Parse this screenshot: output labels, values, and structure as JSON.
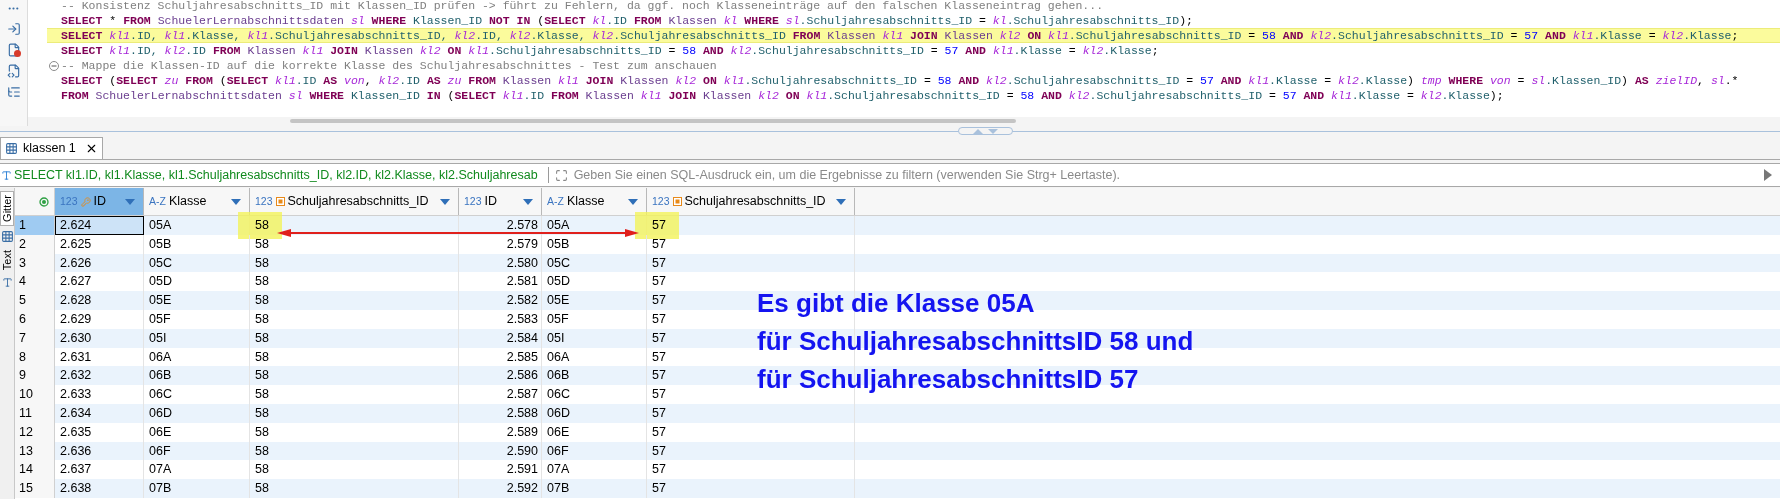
{
  "editor": {
    "lines": [
      {
        "fold_marker": false,
        "highlighted": false,
        "tokens": [
          {
            "kind": "comment",
            "text": "-- Konsistenz Schuljahresabschnitts_ID mit Klassen_ID prüfen -> führt zu Fehlern, da ggf. noch Klasseneinträge auf den falschen Klasseneintrag gehen..."
          }
        ]
      },
      {
        "fold_marker": false,
        "highlighted": false,
        "tokens": [
          {
            "kind": "keyword",
            "text": "SELECT "
          },
          {
            "kind": "plain",
            "text": "* "
          },
          {
            "kind": "keyword",
            "text": "FROM "
          },
          {
            "kind": "table",
            "text": "SchuelerLernabschnittsdaten "
          },
          {
            "kind": "alias",
            "text": "sl "
          },
          {
            "kind": "keyword",
            "text": "WHERE "
          },
          {
            "kind": "column",
            "text": "Klassen_ID "
          },
          {
            "kind": "keyword",
            "text": "NOT IN "
          },
          {
            "kind": "plain",
            "text": "("
          },
          {
            "kind": "keyword",
            "text": "SELECT "
          },
          {
            "kind": "alias",
            "text": "kl"
          },
          {
            "kind": "column",
            "text": ".ID "
          },
          {
            "kind": "keyword",
            "text": "FROM "
          },
          {
            "kind": "table",
            "text": "Klassen "
          },
          {
            "kind": "alias",
            "text": "kl "
          },
          {
            "kind": "keyword",
            "text": "WHERE "
          },
          {
            "kind": "alias",
            "text": "sl"
          },
          {
            "kind": "column",
            "text": ".Schuljahresabschnitts_ID "
          },
          {
            "kind": "plain",
            "text": "= "
          },
          {
            "kind": "alias",
            "text": "kl"
          },
          {
            "kind": "column",
            "text": ".Schuljahresabschnitts_ID"
          },
          {
            "kind": "plain",
            "text": ");"
          }
        ]
      },
      {
        "fold_marker": false,
        "highlighted": true,
        "tokens": [
          {
            "kind": "keyword",
            "text": "SELECT "
          },
          {
            "kind": "alias",
            "text": "kl1"
          },
          {
            "kind": "column",
            "text": ".ID, "
          },
          {
            "kind": "alias",
            "text": "kl1"
          },
          {
            "kind": "column",
            "text": ".Klasse, "
          },
          {
            "kind": "alias",
            "text": "kl1"
          },
          {
            "kind": "column",
            "text": ".Schuljahresabschnitts_ID, "
          },
          {
            "kind": "alias",
            "text": "kl2"
          },
          {
            "kind": "column",
            "text": ".ID, "
          },
          {
            "kind": "alias",
            "text": "kl2"
          },
          {
            "kind": "column",
            "text": ".Klasse, "
          },
          {
            "kind": "alias",
            "text": "kl2"
          },
          {
            "kind": "column",
            "text": ".Schuljahresabschnitts_ID "
          },
          {
            "kind": "keyword",
            "text": "FROM "
          },
          {
            "kind": "table",
            "text": "Klassen "
          },
          {
            "kind": "alias",
            "text": "kl1 "
          },
          {
            "kind": "keyword",
            "text": "JOIN "
          },
          {
            "kind": "table",
            "text": "Klassen "
          },
          {
            "kind": "alias",
            "text": "kl2 "
          },
          {
            "kind": "keyword",
            "text": "ON "
          },
          {
            "kind": "alias",
            "text": "kl1"
          },
          {
            "kind": "column",
            "text": ".Schuljahresabschnitts_ID "
          },
          {
            "kind": "plain",
            "text": "= "
          },
          {
            "kind": "number",
            "text": "58 "
          },
          {
            "kind": "keyword",
            "text": "AND "
          },
          {
            "kind": "alias",
            "text": "kl2"
          },
          {
            "kind": "column",
            "text": ".Schuljahresabschnitts_ID "
          },
          {
            "kind": "plain",
            "text": "= "
          },
          {
            "kind": "number",
            "text": "57 "
          },
          {
            "kind": "keyword",
            "text": "AND "
          },
          {
            "kind": "alias",
            "text": "kl1"
          },
          {
            "kind": "column",
            "text": ".Klasse "
          },
          {
            "kind": "plain",
            "text": "= "
          },
          {
            "kind": "alias",
            "text": "kl2"
          },
          {
            "kind": "column",
            "text": ".Klasse"
          },
          {
            "kind": "plain",
            "text": ";"
          }
        ]
      },
      {
        "fold_marker": false,
        "highlighted": false,
        "tokens": [
          {
            "kind": "keyword",
            "text": "SELECT "
          },
          {
            "kind": "alias",
            "text": "kl1"
          },
          {
            "kind": "column",
            "text": ".ID, "
          },
          {
            "kind": "alias",
            "text": "kl2"
          },
          {
            "kind": "column",
            "text": ".ID "
          },
          {
            "kind": "keyword",
            "text": "FROM "
          },
          {
            "kind": "table",
            "text": "Klassen "
          },
          {
            "kind": "alias",
            "text": "kl1 "
          },
          {
            "kind": "keyword",
            "text": "JOIN "
          },
          {
            "kind": "table",
            "text": "Klassen "
          },
          {
            "kind": "alias",
            "text": "kl2 "
          },
          {
            "kind": "keyword",
            "text": "ON "
          },
          {
            "kind": "alias",
            "text": "kl1"
          },
          {
            "kind": "column",
            "text": ".Schuljahresabschnitts_ID "
          },
          {
            "kind": "plain",
            "text": "= "
          },
          {
            "kind": "number",
            "text": "58 "
          },
          {
            "kind": "keyword",
            "text": "AND "
          },
          {
            "kind": "alias",
            "text": "kl2"
          },
          {
            "kind": "column",
            "text": ".Schuljahresabschnitts_ID "
          },
          {
            "kind": "plain",
            "text": "= "
          },
          {
            "kind": "number",
            "text": "57 "
          },
          {
            "kind": "keyword",
            "text": "AND "
          },
          {
            "kind": "alias",
            "text": "kl1"
          },
          {
            "kind": "column",
            "text": ".Klasse "
          },
          {
            "kind": "plain",
            "text": "= "
          },
          {
            "kind": "alias",
            "text": "kl2"
          },
          {
            "kind": "column",
            "text": ".Klasse"
          },
          {
            "kind": "plain",
            "text": ";"
          }
        ]
      },
      {
        "fold_marker": true,
        "highlighted": false,
        "tokens": [
          {
            "kind": "comment",
            "text": "-- Mappe die Klassen-ID auf die korrekte Klasse des Schuljahresabschnittes - Test zum anschauen"
          }
        ]
      },
      {
        "fold_marker": false,
        "highlighted": false,
        "tokens": [
          {
            "kind": "keyword",
            "text": "SELECT "
          },
          {
            "kind": "plain",
            "text": "("
          },
          {
            "kind": "keyword",
            "text": "SELECT "
          },
          {
            "kind": "alias",
            "text": "zu "
          },
          {
            "kind": "keyword",
            "text": "FROM "
          },
          {
            "kind": "plain",
            "text": "("
          },
          {
            "kind": "keyword",
            "text": "SELECT "
          },
          {
            "kind": "alias",
            "text": "kl1"
          },
          {
            "kind": "column",
            "text": ".ID "
          },
          {
            "kind": "keyword",
            "text": "AS "
          },
          {
            "kind": "alias",
            "text": "von"
          },
          {
            "kind": "plain",
            "text": ", "
          },
          {
            "kind": "alias",
            "text": "kl2"
          },
          {
            "kind": "column",
            "text": ".ID "
          },
          {
            "kind": "keyword",
            "text": "AS "
          },
          {
            "kind": "alias",
            "text": "zu "
          },
          {
            "kind": "keyword",
            "text": "FROM "
          },
          {
            "kind": "table",
            "text": "Klassen "
          },
          {
            "kind": "alias",
            "text": "kl1 "
          },
          {
            "kind": "keyword",
            "text": "JOIN "
          },
          {
            "kind": "table",
            "text": "Klassen "
          },
          {
            "kind": "alias",
            "text": "kl2 "
          },
          {
            "kind": "keyword",
            "text": "ON "
          },
          {
            "kind": "alias",
            "text": "kl1"
          },
          {
            "kind": "column",
            "text": ".Schuljahresabschnitts_ID "
          },
          {
            "kind": "plain",
            "text": "= "
          },
          {
            "kind": "number",
            "text": "58 "
          },
          {
            "kind": "keyword",
            "text": "AND "
          },
          {
            "kind": "alias",
            "text": "kl2"
          },
          {
            "kind": "column",
            "text": ".Schuljahresabschnitts_ID "
          },
          {
            "kind": "plain",
            "text": "= "
          },
          {
            "kind": "number",
            "text": "57 "
          },
          {
            "kind": "keyword",
            "text": "AND "
          },
          {
            "kind": "alias",
            "text": "kl1"
          },
          {
            "kind": "column",
            "text": ".Klasse "
          },
          {
            "kind": "plain",
            "text": "= "
          },
          {
            "kind": "alias",
            "text": "kl2"
          },
          {
            "kind": "column",
            "text": ".Klasse"
          },
          {
            "kind": "plain",
            "text": ") "
          },
          {
            "kind": "alias",
            "text": "tmp "
          },
          {
            "kind": "keyword",
            "text": "WHERE "
          },
          {
            "kind": "alias",
            "text": "von "
          },
          {
            "kind": "plain",
            "text": "= "
          },
          {
            "kind": "alias",
            "text": "sl"
          },
          {
            "kind": "column",
            "text": ".Klassen_ID"
          },
          {
            "kind": "plain",
            "text": ") "
          },
          {
            "kind": "keyword",
            "text": "AS "
          },
          {
            "kind": "alias",
            "text": "zielID"
          },
          {
            "kind": "plain",
            "text": ", "
          },
          {
            "kind": "alias",
            "text": "sl"
          },
          {
            "kind": "plain",
            "text": ".*"
          }
        ]
      },
      {
        "fold_marker": false,
        "highlighted": false,
        "tokens": [
          {
            "kind": "keyword",
            "text": "FROM "
          },
          {
            "kind": "table",
            "text": "SchuelerLernabschnittsdaten "
          },
          {
            "kind": "alias",
            "text": "sl "
          },
          {
            "kind": "keyword",
            "text": "WHERE "
          },
          {
            "kind": "column",
            "text": "Klassen_ID "
          },
          {
            "kind": "keyword",
            "text": "IN "
          },
          {
            "kind": "plain",
            "text": "("
          },
          {
            "kind": "keyword",
            "text": "SELECT "
          },
          {
            "kind": "alias",
            "text": "kl1"
          },
          {
            "kind": "column",
            "text": ".ID "
          },
          {
            "kind": "keyword",
            "text": "FROM "
          },
          {
            "kind": "table",
            "text": "Klassen "
          },
          {
            "kind": "alias",
            "text": "kl1 "
          },
          {
            "kind": "keyword",
            "text": "JOIN "
          },
          {
            "kind": "table",
            "text": "Klassen "
          },
          {
            "kind": "alias",
            "text": "kl2 "
          },
          {
            "kind": "keyword",
            "text": "ON "
          },
          {
            "kind": "alias",
            "text": "kl1"
          },
          {
            "kind": "column",
            "text": ".Schuljahresabschnitts_ID "
          },
          {
            "kind": "plain",
            "text": "= "
          },
          {
            "kind": "number",
            "text": "58 "
          },
          {
            "kind": "keyword",
            "text": "AND "
          },
          {
            "kind": "alias",
            "text": "kl2"
          },
          {
            "kind": "column",
            "text": ".Schuljahresabschnitts_ID "
          },
          {
            "kind": "plain",
            "text": "= "
          },
          {
            "kind": "number",
            "text": "57 "
          },
          {
            "kind": "keyword",
            "text": "AND "
          },
          {
            "kind": "alias",
            "text": "kl1"
          },
          {
            "kind": "column",
            "text": ".Klasse "
          },
          {
            "kind": "plain",
            "text": "= "
          },
          {
            "kind": "alias",
            "text": "kl2"
          },
          {
            "kind": "column",
            "text": ".Klasse"
          },
          {
            "kind": "plain",
            "text": ");"
          }
        ]
      }
    ]
  },
  "result_tabs": [
    {
      "label": "klassen 1",
      "selected": true
    }
  ],
  "filter_bar": {
    "query": "SELECT kl1.ID, kl1.Klasse, kl1.Schuljahresabschnitts_ID, kl2.ID, kl2.Klasse, kl2.Schuljahresab",
    "placeholder": "Geben Sie einen SQL-Ausdruck ein, um die Ergebnisse zu filtern (verwenden Sie Strg+ Leertaste)."
  },
  "view_tabs": [
    {
      "label": "Gitter",
      "selected": true
    },
    {
      "label": "Text",
      "selected": false
    }
  ],
  "table": {
    "columns": [
      {
        "type": "123",
        "name": "ID",
        "primary_key": true,
        "reference": false,
        "selected": true
      },
      {
        "type": "A-Z",
        "name": "Klasse",
        "primary_key": false,
        "reference": false,
        "selected": false
      },
      {
        "type": "123",
        "name": "Schuljahresabschnitts_ID",
        "primary_key": false,
        "reference": true,
        "selected": false
      },
      {
        "type": "123",
        "name": "ID",
        "primary_key": false,
        "reference": false,
        "selected": false
      },
      {
        "type": "A-Z",
        "name": "Klasse",
        "primary_key": false,
        "reference": false,
        "selected": false
      },
      {
        "type": "123",
        "name": "Schuljahresabschnitts_ID",
        "primary_key": false,
        "reference": true,
        "selected": false
      }
    ],
    "rows": [
      {
        "number": "1",
        "selected": true,
        "marked": true,
        "cells": [
          "2.624",
          "05A",
          "58",
          "2.578",
          "05A",
          "57"
        ]
      },
      {
        "number": "2",
        "selected": false,
        "marked": false,
        "cells": [
          "2.625",
          "05B",
          "58",
          "2.579",
          "05B",
          "57"
        ]
      },
      {
        "number": "3",
        "selected": false,
        "marked": false,
        "cells": [
          "2.626",
          "05C",
          "58",
          "2.580",
          "05C",
          "57"
        ]
      },
      {
        "number": "4",
        "selected": false,
        "marked": false,
        "cells": [
          "2.627",
          "05D",
          "58",
          "2.581",
          "05D",
          "57"
        ]
      },
      {
        "number": "5",
        "selected": false,
        "marked": false,
        "cells": [
          "2.628",
          "05E",
          "58",
          "2.582",
          "05E",
          "57"
        ]
      },
      {
        "number": "6",
        "selected": false,
        "marked": false,
        "cells": [
          "2.629",
          "05F",
          "58",
          "2.583",
          "05F",
          "57"
        ]
      },
      {
        "number": "7",
        "selected": false,
        "marked": false,
        "cells": [
          "2.630",
          "05I",
          "58",
          "2.584",
          "05I",
          "57"
        ]
      },
      {
        "number": "8",
        "selected": false,
        "marked": false,
        "cells": [
          "2.631",
          "06A",
          "58",
          "2.585",
          "06A",
          "57"
        ]
      },
      {
        "number": "9",
        "selected": false,
        "marked": false,
        "cells": [
          "2.632",
          "06B",
          "58",
          "2.586",
          "06B",
          "57"
        ]
      },
      {
        "number": "10",
        "selected": false,
        "marked": false,
        "cells": [
          "2.633",
          "06C",
          "58",
          "2.587",
          "06C",
          "57"
        ]
      },
      {
        "number": "11",
        "selected": false,
        "marked": false,
        "cells": [
          "2.634",
          "06D",
          "58",
          "2.588",
          "06D",
          "57"
        ]
      },
      {
        "number": "12",
        "selected": false,
        "marked": false,
        "cells": [
          "2.635",
          "06E",
          "58",
          "2.589",
          "06E",
          "57"
        ]
      },
      {
        "number": "13",
        "selected": false,
        "marked": false,
        "cells": [
          "2.636",
          "06F",
          "58",
          "2.590",
          "06F",
          "57"
        ]
      },
      {
        "number": "14",
        "selected": false,
        "marked": false,
        "cells": [
          "2.637",
          "07A",
          "58",
          "2.591",
          "07A",
          "57"
        ]
      },
      {
        "number": "15",
        "selected": false,
        "marked": false,
        "cells": [
          "2.638",
          "07B",
          "58",
          "2.592",
          "07B",
          "57"
        ]
      }
    ]
  },
  "annotation": [
    "Es gibt die Klasse 05A",
    "für SchuljahresabschnittsID 58 und",
    "für SchuljahresabschnittsID 57"
  ]
}
